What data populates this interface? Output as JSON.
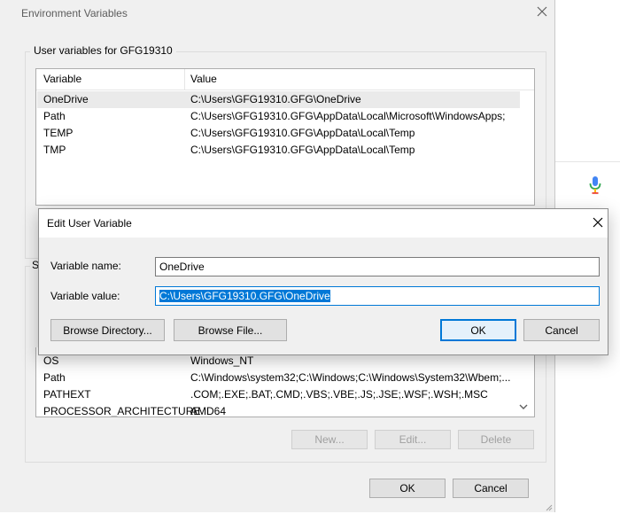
{
  "env_window": {
    "title": "Environment Variables",
    "user_group_title": "User variables for GFG19310",
    "user_list": {
      "columns": [
        "Variable",
        "Value"
      ],
      "rows": [
        {
          "variable": "OneDrive",
          "value": "C:\\Users\\GFG19310.GFG\\OneDrive"
        },
        {
          "variable": "Path",
          "value": "C:\\Users\\GFG19310.GFG\\AppData\\Local\\Microsoft\\WindowsApps;"
        },
        {
          "variable": "TEMP",
          "value": "C:\\Users\\GFG19310.GFG\\AppData\\Local\\Temp"
        },
        {
          "variable": "TMP",
          "value": "C:\\Users\\GFG19310.GFG\\AppData\\Local\\Temp"
        }
      ]
    },
    "system_group_title_fragment": "S",
    "system_list": {
      "rows": [
        {
          "variable": "OS",
          "value": "Windows_NT"
        },
        {
          "variable": "Path",
          "value": "C:\\Windows\\system32;C:\\Windows;C:\\Windows\\System32\\Wbem;..."
        },
        {
          "variable": "PATHEXT",
          "value": ".COM;.EXE;.BAT;.CMD;.VBS;.VBE;.JS;.JSE;.WSF;.WSH;.MSC"
        },
        {
          "variable": "PROCESSOR_ARCHITECTURE",
          "value": "AMD64"
        }
      ]
    },
    "system_buttons": {
      "new": "New...",
      "edit": "Edit...",
      "delete": "Delete"
    },
    "ok_label": "OK",
    "cancel_label": "Cancel"
  },
  "edit_dialog": {
    "title": "Edit User Variable",
    "name_label": "Variable name:",
    "name_value": "OneDrive",
    "value_label": "Variable value:",
    "value_value": "C:\\Users\\GFG19310.GFG\\OneDrive",
    "browse_directory_label": "Browse Directory...",
    "browse_file_label": "Browse File...",
    "ok_label": "OK",
    "cancel_label": "Cancel"
  },
  "colors": {
    "accent": "#0078d7",
    "window_bg": "#f0f0f0",
    "selected_row_bg": "#eaeaea"
  },
  "icons": [
    "close-icon",
    "microphone-icon",
    "scroll-down-arrow-icon",
    "resize-grip-icon"
  ]
}
